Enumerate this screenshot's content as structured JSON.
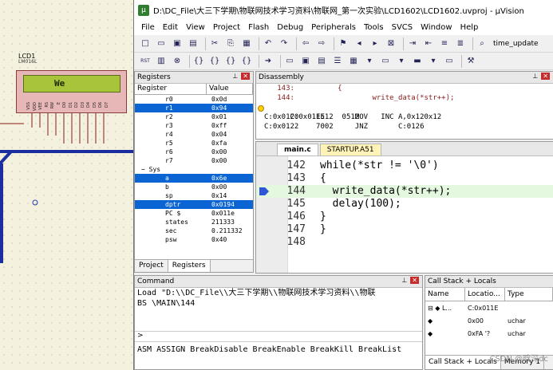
{
  "proteus": {
    "lcd_ref": "LCD1",
    "lcd_part": "LM016L",
    "lcd_text": "We",
    "pin_labels": [
      "VSS",
      "VDD",
      "VEE",
      "RS",
      "RW",
      "E",
      "D0",
      "D1",
      "D2",
      "D3",
      "D4",
      "D5",
      "D6",
      "D7"
    ]
  },
  "window": {
    "title": "D:\\DC_File\\大三下学期\\物联网技术学习资料\\物联网_第一次实验\\LCD1602\\LCD1602.uvproj - µVision"
  },
  "menu": [
    "File",
    "Edit",
    "View",
    "Project",
    "Flash",
    "Debug",
    "Peripherals",
    "Tools",
    "SVCS",
    "Window",
    "Help"
  ],
  "toolbar": {
    "target_label": "time_update",
    "rst_label": "RST"
  },
  "registers": {
    "title": "Registers",
    "col_register": "Register",
    "col_value": "Value",
    "rows": [
      {
        "name": "r0",
        "value": "0x0d"
      },
      {
        "name": "r1",
        "value": "0x94"
      },
      {
        "name": "r2",
        "value": "0x01"
      },
      {
        "name": "r3",
        "value": "0xff"
      },
      {
        "name": "r4",
        "value": "0x04"
      },
      {
        "name": "r5",
        "value": "0xfa"
      },
      {
        "name": "r6",
        "value": "0x00"
      },
      {
        "name": "r7",
        "value": "0x00"
      }
    ],
    "sys_label": "Sys",
    "sys_rows": [
      {
        "name": "a",
        "value": "0x6e"
      },
      {
        "name": "b",
        "value": "0x00"
      },
      {
        "name": "sp",
        "value": "0x14"
      },
      {
        "name": "dptr",
        "value": "0x0194"
      },
      {
        "name": "PC  $",
        "value": "0x011e"
      },
      {
        "name": "states",
        "value": "211333"
      },
      {
        "name": "sec",
        "value": "0.211332"
      },
      {
        "name": "psw",
        "value": "0x40"
      }
    ],
    "tab_project": "Project",
    "tab_registers": "Registers"
  },
  "disassembly": {
    "title": "Disassembly",
    "lines": [
      "   143:          {",
      "   144:                  write_data(*str++);",
      "C:0x011E    0512     INC       0x12",
      "C:0x0120    E512     MOV       A,0x12",
      "C:0x0122    7002     JNZ       C:0126"
    ]
  },
  "editor": {
    "tabs": [
      "main.c",
      "STARTUP.A51"
    ],
    "lines": [
      {
        "num": "142",
        "code": "while(*str != '\\0')"
      },
      {
        "num": "143",
        "code": "{"
      },
      {
        "num": "144",
        "code": "  write_data(*str++);"
      },
      {
        "num": "145",
        "code": "  delay(100);"
      },
      {
        "num": "146",
        "code": "}"
      },
      {
        "num": "147",
        "code": "}"
      },
      {
        "num": "148",
        "code": ""
      }
    ]
  },
  "command": {
    "title": "Command",
    "output_line1": "Load \"D:\\\\DC_File\\\\大三下学期\\\\物联网技术学习资料\\\\物联",
    "output_line2": "BS \\MAIN\\144",
    "prompt": ">",
    "help": "ASM ASSIGN BreakDisable BreakEnable BreakKill BreakList"
  },
  "callstack": {
    "title": "Call Stack + Locals",
    "col_name": "Name",
    "col_location": "Locatio...",
    "col_type": "Type",
    "rows": [
      {
        "name": "L...",
        "location": "C:0x011E",
        "type": ""
      },
      {
        "name": "",
        "location": "0x00",
        "type": "uchar"
      },
      {
        "name": "",
        "location": "0xFA '?",
        "type": "uchar"
      }
    ],
    "tab1": "Call Stack + Locals",
    "tab2": "Memory 1"
  },
  "watermark": "CSDN @晗深dc"
}
